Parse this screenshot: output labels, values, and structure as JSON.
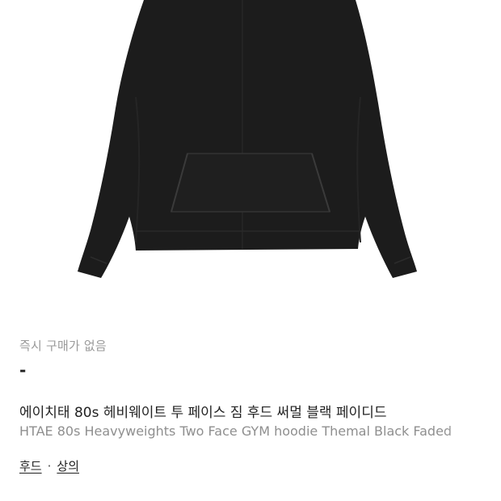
{
  "product": {
    "image_alt": "black hoodie",
    "instant_purchase_label": "즉시 구매가 없음",
    "price": "-",
    "title_ko": "에이치태 80s 헤비웨이트 투 페이스 짐 후드 써멀 블랙 페이디드",
    "title_en": "HTAE 80s Heavyweights Two Face GYM hoodie Themal Black Faded",
    "categories": [
      {
        "label": "후드"
      },
      {
        "label": "상의"
      }
    ],
    "category_separator": "·"
  },
  "colors": {
    "garment": "#1c1c1c",
    "text_primary": "#222222",
    "text_secondary": "#9a9a9a"
  }
}
